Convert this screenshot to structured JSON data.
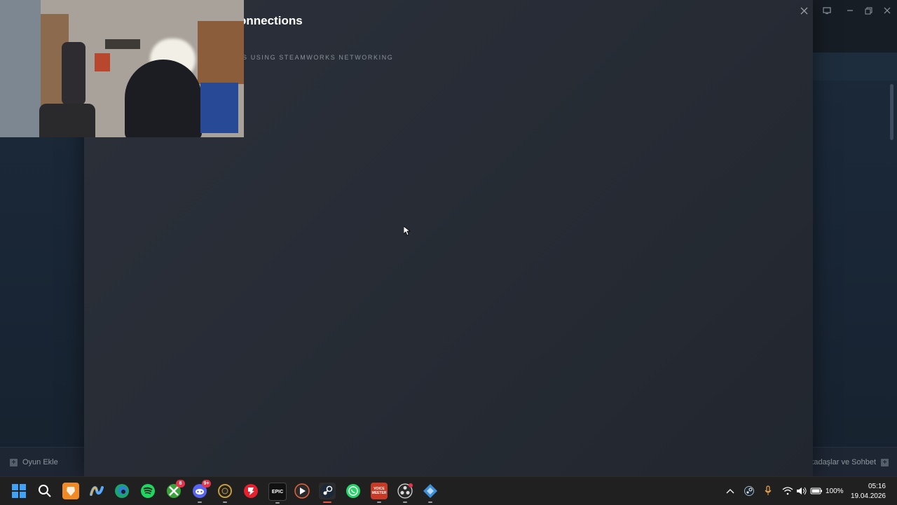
{
  "modal": {
    "title": "onnections",
    "subtitle": "S USING STEAMWORKS NETWORKING"
  },
  "steam_footer": {
    "add_game_label": "Oyun Ekle",
    "friends_chat_label": "kadaşlar ve Sohbet"
  },
  "taskbar": {
    "icons": [
      {
        "name": "windows-start-icon"
      },
      {
        "name": "search-icon"
      },
      {
        "name": "brave-browser-icon"
      },
      {
        "name": "copilot-icon"
      },
      {
        "name": "edge-icon"
      },
      {
        "name": "spotify-icon"
      },
      {
        "name": "xbox-icon",
        "badge": "8"
      },
      {
        "name": "discord-icon",
        "badge": "9+"
      },
      {
        "name": "riot-client-icon"
      },
      {
        "name": "razer-icon"
      },
      {
        "name": "epic-games-icon",
        "label": "EPIC"
      },
      {
        "name": "media-player-icon"
      },
      {
        "name": "steam-icon"
      },
      {
        "name": "whatsapp-icon"
      },
      {
        "name": "voicemeeter-icon",
        "label": "VOICE MEETER"
      },
      {
        "name": "obs-icon"
      },
      {
        "name": "snipping-tool-icon"
      }
    ],
    "battery_percent": "100%",
    "time": "05:16",
    "date": "19.04.2026"
  },
  "colors": {
    "steam_bg": "#1b2838",
    "modal_bg": "#282d36",
    "taskbar_bg": "#202020",
    "accent_steam": "#66c0f4"
  }
}
